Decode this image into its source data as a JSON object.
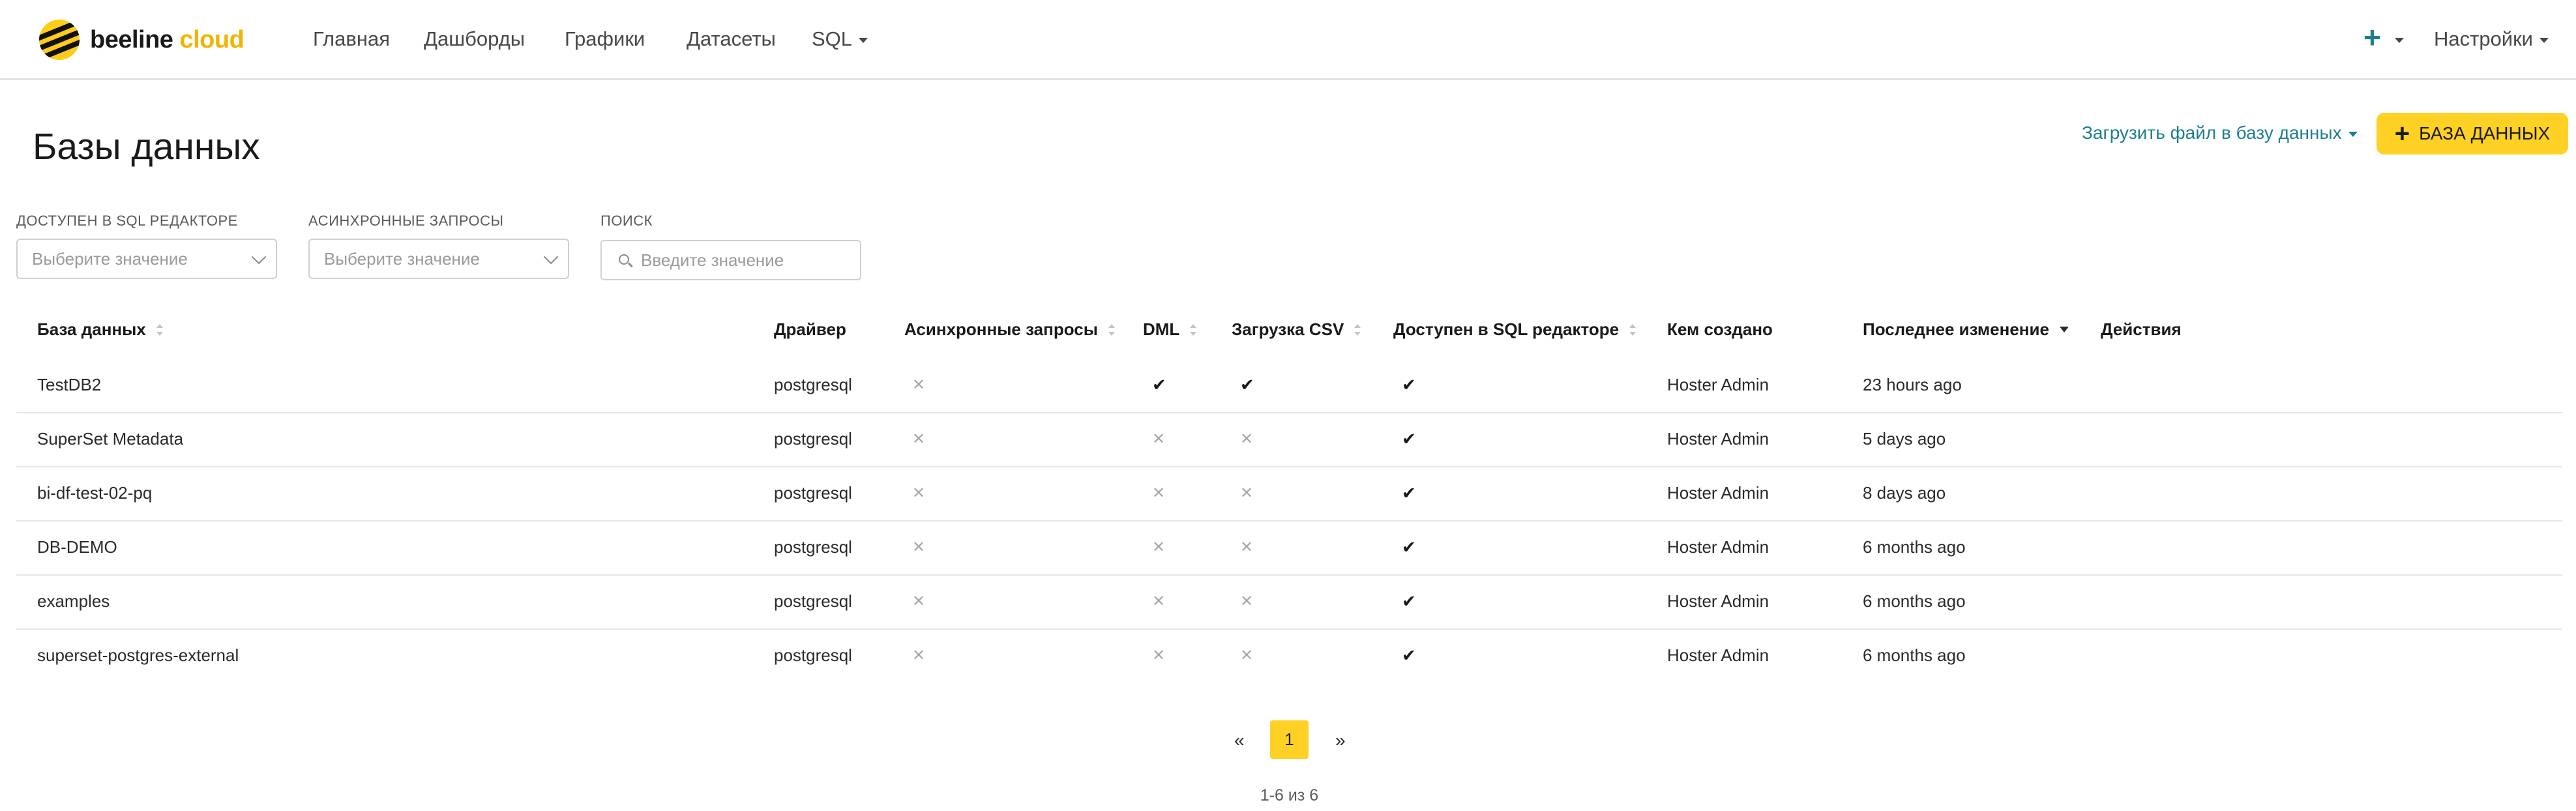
{
  "brand": {
    "name_part1": "beeline",
    "name_part2": "cloud"
  },
  "nav": {
    "items": [
      "Главная",
      "Дашборды",
      "Графики",
      "Датасеты",
      "SQL"
    ],
    "plus_label": "+",
    "settings_label": "Настройки"
  },
  "page": {
    "title": "Базы данных",
    "upload_link": "Загрузить файл в базу данных",
    "add_button": "БАЗА ДАННЫХ",
    "add_button_icon": "+"
  },
  "filters": [
    {
      "label": "ДОСТУПЕН В SQL РЕДАКТОРЕ",
      "placeholder": "Выберите значение"
    },
    {
      "label": "АСИНХРОННЫЕ ЗАПРОСЫ",
      "placeholder": "Выберите значение"
    },
    {
      "label": "ПОИСК",
      "placeholder": "Введите значение"
    }
  ],
  "table": {
    "columns": [
      "База данных",
      "Драйвер",
      "Асинхронные запросы",
      "DML",
      "Загрузка CSV",
      "Доступен в SQL редакторе",
      "Кем создано",
      "Последнее изменение",
      "Действия"
    ],
    "check_glyph": "✔",
    "cross_glyph": "✕",
    "rows": [
      {
        "name": "TestDB2",
        "driver": "postgresql",
        "async": false,
        "dml": true,
        "csv": true,
        "sql_lab": true,
        "created_by": "Hoster Admin",
        "changed": "23 hours ago"
      },
      {
        "name": "SuperSet Metadata",
        "driver": "postgresql",
        "async": false,
        "dml": false,
        "csv": false,
        "sql_lab": true,
        "created_by": "Hoster Admin",
        "changed": "5 days ago"
      },
      {
        "name": "bi-df-test-02-pq",
        "driver": "postgresql",
        "async": false,
        "dml": false,
        "csv": false,
        "sql_lab": true,
        "created_by": "Hoster Admin",
        "changed": "8 days ago"
      },
      {
        "name": "DB-DEMO",
        "driver": "postgresql",
        "async": false,
        "dml": false,
        "csv": false,
        "sql_lab": true,
        "created_by": "Hoster Admin",
        "changed": "6 months ago"
      },
      {
        "name": "examples",
        "driver": "postgresql",
        "async": false,
        "dml": false,
        "csv": false,
        "sql_lab": true,
        "created_by": "Hoster Admin",
        "changed": "6 months ago"
      },
      {
        "name": "superset-postgres-external",
        "driver": "postgresql",
        "async": false,
        "dml": false,
        "csv": false,
        "sql_lab": true,
        "created_by": "Hoster Admin",
        "changed": "6 months ago"
      }
    ]
  },
  "pagination": {
    "prev": "«",
    "current": "1",
    "next": "»",
    "info": "1-6 из 6"
  },
  "colors": {
    "accent_yellow": "#ffd124",
    "link_teal": "#1e7f8d"
  }
}
